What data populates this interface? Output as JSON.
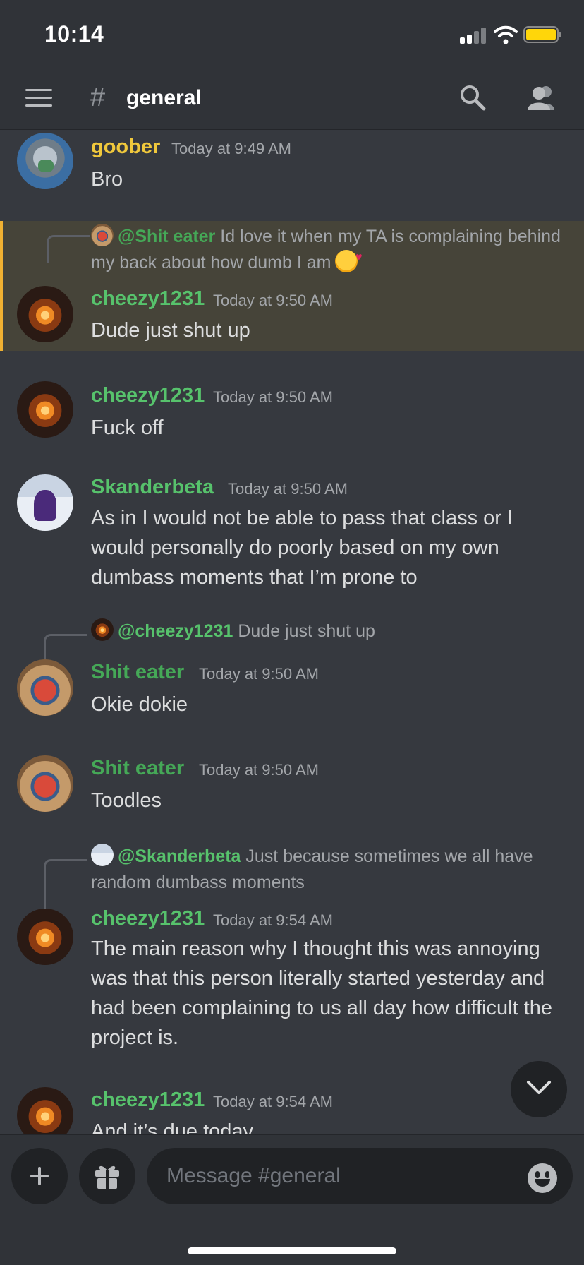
{
  "status_bar": {
    "time": "10:14"
  },
  "header": {
    "channel_name": "general"
  },
  "colors": {
    "accent_green": "#57c26c",
    "name_yellow": "#f0c83c",
    "name_dark_green": "#45a857",
    "highlight_bar": "#f0b132"
  },
  "messages": [
    {
      "author": "goober",
      "author_color": "#f0c83c",
      "timestamp": "Today at 9:49 AM",
      "text": "Bro",
      "avatar": "pigeon-avatar"
    },
    {
      "reply": {
        "mention": "@Shit eater",
        "text": "Id love it when my TA is complaining behind my back about how dumb I am",
        "emoji": "smiling-face-with-hearts"
      },
      "author": "cheezy1231",
      "author_color": "#57c26c",
      "timestamp": "Today at 9:50 AM",
      "text": "Dude just shut up",
      "avatar": "fire-avatar",
      "highlighted": true
    },
    {
      "author": "cheezy1231",
      "author_color": "#57c26c",
      "timestamp": "Today at 9:50 AM",
      "text": "Fuck off",
      "avatar": "fire-avatar"
    },
    {
      "author": "Skanderbeta",
      "author_color": "#57c26c",
      "timestamp": "Today at 9:50 AM",
      "text": "As in I would not be able to pass that class or I would personally do poorly based on my own dumbass moments that I’m prone to",
      "avatar": "purple-avatar"
    },
    {
      "reply": {
        "mention": "@cheezy1231",
        "text": "Dude just shut up"
      },
      "author": "Shit eater",
      "author_color": "#45a857",
      "timestamp": "Today at 9:50 AM",
      "text": "Okie dokie",
      "avatar": "crab-avatar"
    },
    {
      "author": "Shit eater",
      "author_color": "#45a857",
      "timestamp": "Today at 9:50 AM",
      "text": "Toodles",
      "avatar": "crab-avatar"
    },
    {
      "reply": {
        "mention": "@Skanderbeta",
        "text": "Just because sometimes we all have random dumbass moments"
      },
      "author": "cheezy1231",
      "author_color": "#57c26c",
      "timestamp": "Today at 9:54 AM",
      "text": "The main reason why I thought this was annoying was that this person literally started yesterday and had been complaining to us all day how difficult the project is.",
      "avatar": "fire-avatar"
    },
    {
      "author": "cheezy1231",
      "author_color": "#57c26c",
      "timestamp": "Today at 9:54 AM",
      "text": "And it’s due today",
      "avatar": "fire-avatar"
    }
  ],
  "composer": {
    "placeholder": "Message #general"
  }
}
